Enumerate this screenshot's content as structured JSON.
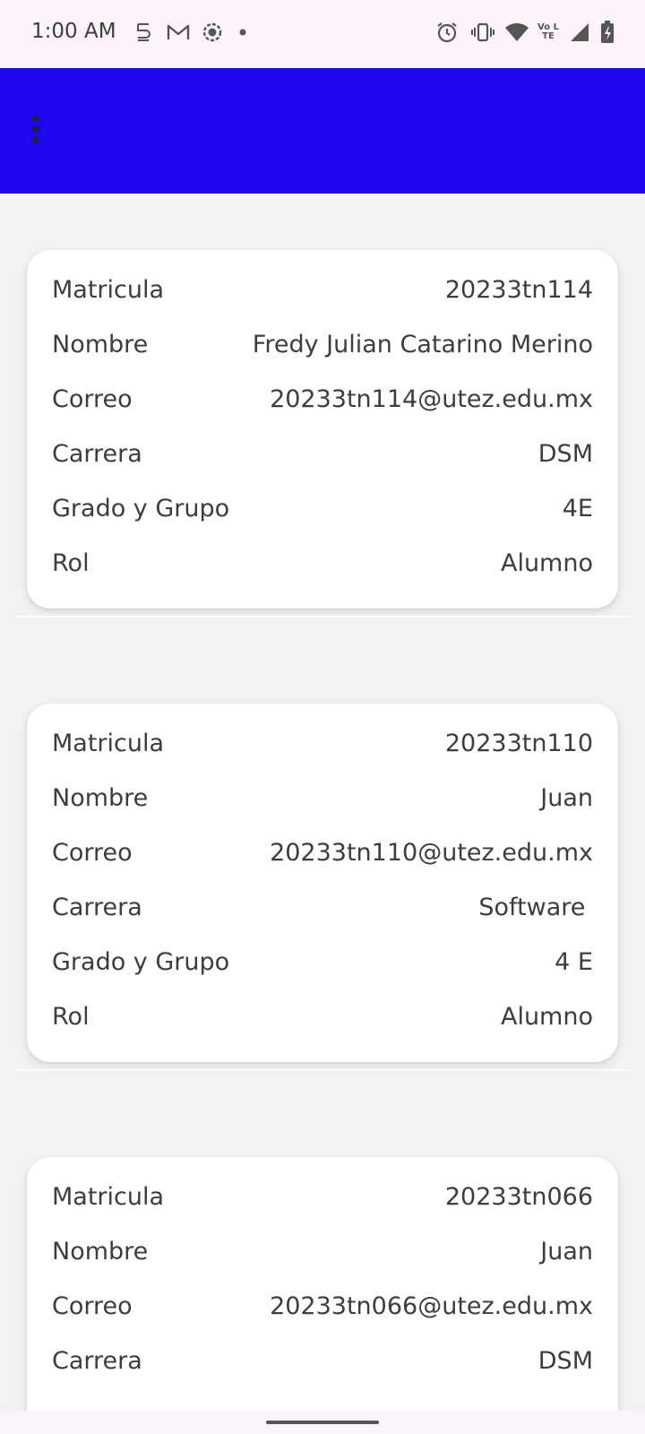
{
  "status_bar": {
    "time": "1:00 AM",
    "left_icons": [
      "s-sim-icon",
      "gmail-icon",
      "record-icon",
      "dot-icon"
    ],
    "right_icons": [
      "alarm-icon",
      "vibrate-icon",
      "wifi-icon",
      "volte-icon",
      "signal-icon",
      "battery-icon"
    ],
    "volte_label": "Vo LTE"
  },
  "app_bar": {
    "menu_icon": "more-vert-icon",
    "color": "#1e06f0"
  },
  "students": [
    {
      "fields": [
        {
          "label": "Matricula",
          "value": "20233tn114"
        },
        {
          "label": "Nombre",
          "value": "Fredy Julian Catarino Merino"
        },
        {
          "label": "Correo",
          "value": "20233tn114@utez.edu.mx"
        },
        {
          "label": "Carrera",
          "value": "DSM"
        },
        {
          "label": "Grado y Grupo",
          "value": "4E"
        },
        {
          "label": "Rol",
          "value": "Alumno"
        }
      ]
    },
    {
      "fields": [
        {
          "label": "Matricula",
          "value": "20233tn110"
        },
        {
          "label": "Nombre",
          "value": "Juan"
        },
        {
          "label": "Correo",
          "value": "20233tn110@utez.edu.mx"
        },
        {
          "label": "Carrera",
          "value": "Software "
        },
        {
          "label": "Grado y Grupo",
          "value": "4 E"
        },
        {
          "label": "Rol",
          "value": "Alumno"
        }
      ]
    },
    {
      "fields": [
        {
          "label": "Matricula",
          "value": "20233tn066"
        },
        {
          "label": "Nombre",
          "value": "Juan"
        },
        {
          "label": "Correo",
          "value": "20233tn066@utez.edu.mx"
        },
        {
          "label": "Carrera",
          "value": "DSM"
        }
      ]
    }
  ]
}
